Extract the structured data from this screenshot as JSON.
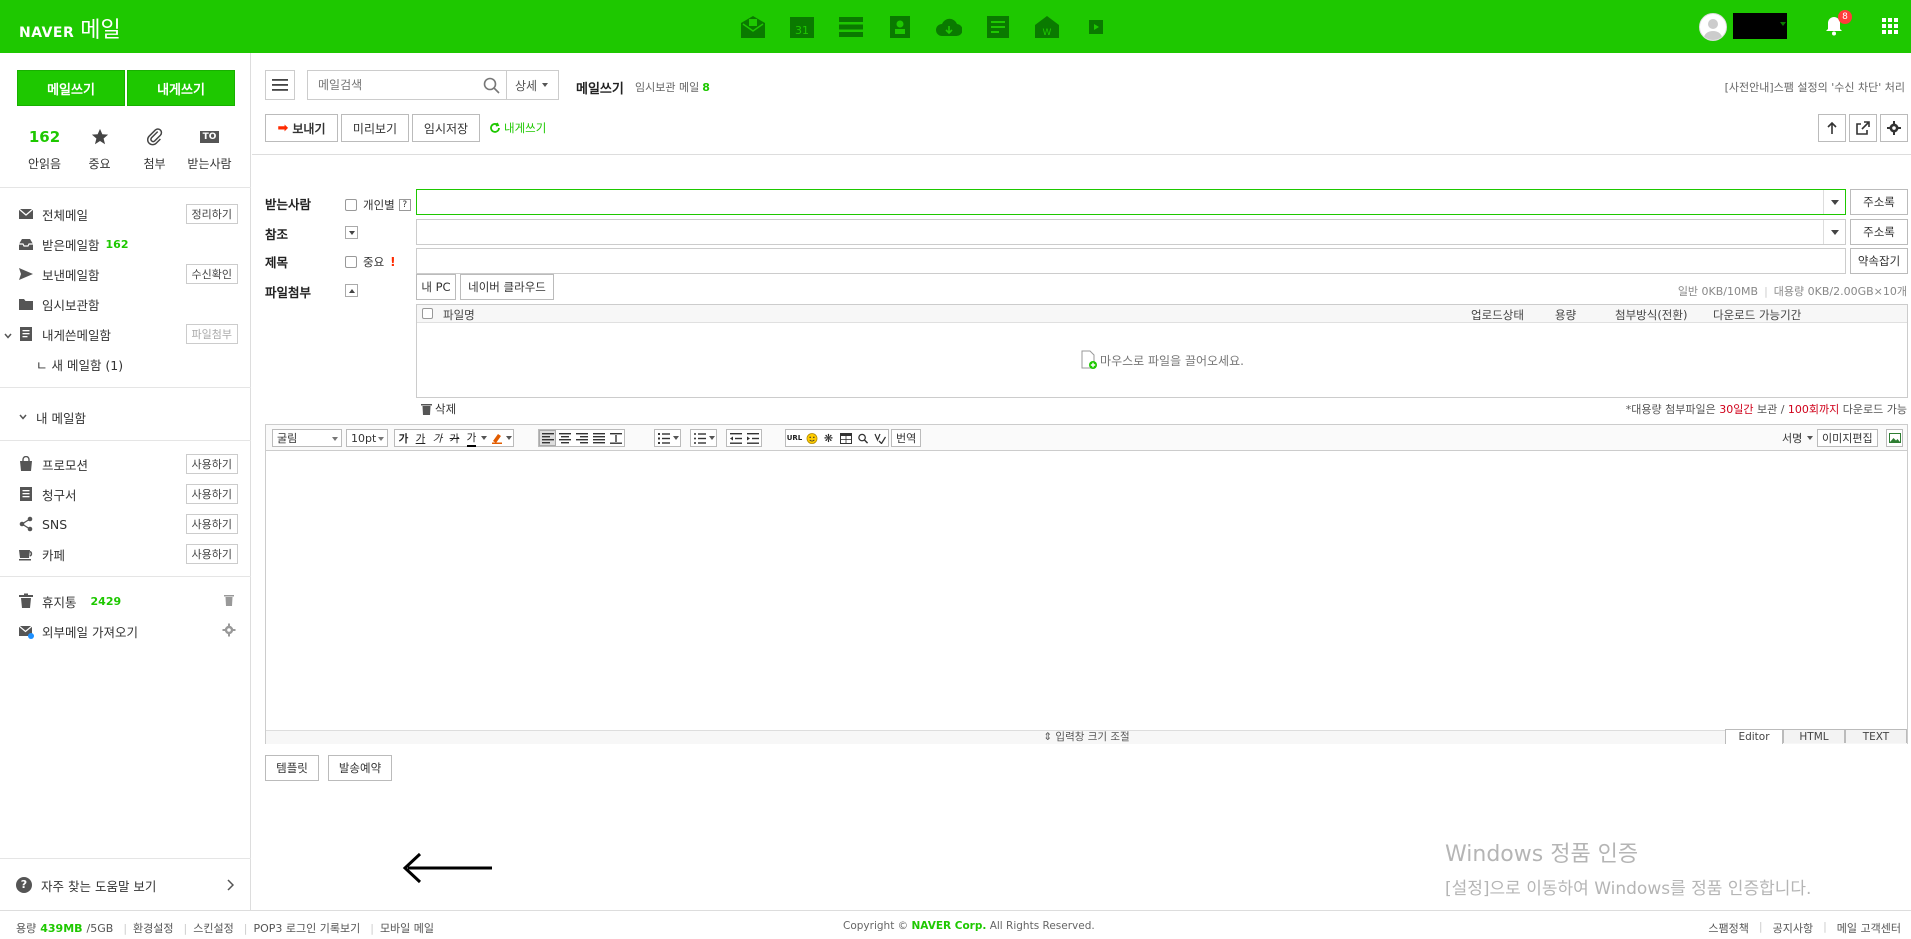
{
  "header": {
    "brand": "NAVER",
    "product": "메일",
    "notification_count": "8"
  },
  "sidebar": {
    "compose_label": "메일쓰기",
    "self_compose_label": "내게쓰기",
    "quick": [
      {
        "value": "162",
        "label": "안읽음"
      },
      {
        "label": "중요"
      },
      {
        "label": "첨부"
      },
      {
        "badge": "TO",
        "label": "받는사람"
      }
    ],
    "folders": [
      {
        "label": "전체메일",
        "button": "정리하기"
      },
      {
        "label": "받은메일함",
        "count": "162"
      },
      {
        "label": "보낸메일함",
        "button": "수신확인"
      },
      {
        "label": "임시보관함"
      },
      {
        "label": "내게쓴메일함",
        "button": "파일첨부"
      },
      {
        "label": "ㄴ 새 메일함 (1)"
      }
    ],
    "my_mailbox_label": "내 메일함",
    "apps": [
      {
        "label": "프로모션",
        "button": "사용하기"
      },
      {
        "label": "청구서",
        "button": "사용하기"
      },
      {
        "label": "SNS",
        "button": "사용하기"
      },
      {
        "label": "카페",
        "button": "사용하기"
      }
    ],
    "trash": {
      "label": "휴지통",
      "count": "2429"
    },
    "external": {
      "label": "외부메일 가져오기"
    },
    "help_label": "자주 찾는 도움말 보기"
  },
  "main": {
    "search_placeholder": "메일검색",
    "detail_label": "상세",
    "title": "메일쓰기",
    "draft_label": "임시보관 메일",
    "draft_count": "8",
    "notice": "[사전안내]스팸 설정의 '수신 차단' 처리",
    "toolbar": {
      "send": "보내기",
      "preview": "미리보기",
      "save": "임시저장",
      "self_write": "내게쓰기"
    },
    "form": {
      "to_label": "받는사람",
      "personal_label": "개인별",
      "help_mark": "?",
      "address_book": "주소록",
      "cc_label": "참조",
      "subject_label": "제목",
      "important_label": "중요",
      "important_mark": "!",
      "signature_btn": "약속잡기",
      "attach_label": "파일첨부",
      "my_pc": "내 PC",
      "cloud": "네이버 클라우드",
      "quota_normal": "일반 0KB/10MB",
      "quota_big": "대용량 0KB/2.00GB×10개"
    },
    "file_table": {
      "columns": [
        "파일명",
        "업로드상태",
        "용량",
        "첨부방식(전환)",
        "다운로드 가능기간"
      ],
      "drop_text": "마우스로 파일을 끌어오세요.",
      "delete": "삭제",
      "note_prefix": "*대용량 첨부파일은 ",
      "note_days": "30일간",
      "note_mid": " 보관 / ",
      "note_times": "100회까지",
      "note_suffix": " 다운로드 가능"
    },
    "editor": {
      "font": "굴림",
      "size": "10pt",
      "translate": "번역",
      "sign": "서명",
      "image_edit": "이미지편집",
      "resize": "입력창 크기 조절",
      "modes": [
        "Editor",
        "HTML",
        "TEXT"
      ]
    },
    "bottom": {
      "template": "템플릿",
      "schedule": "발송예약"
    }
  },
  "footer": {
    "usage_label": "용량",
    "usage_value": "439MB",
    "usage_total": "/5GB",
    "links_left": [
      "환경설정",
      "스킨설정",
      "POP3 로그인 기록보기",
      "모바일 메일"
    ],
    "copyright_prefix": "Copyright ©",
    "copyright_brand": "NAVER Corp.",
    "copyright_suffix": "All Rights Reserved.",
    "links_right": [
      "스팸정책",
      "공지사항",
      "메일 고객센터"
    ]
  },
  "watermark": {
    "line1": "Windows 정품 인증",
    "line2": "[설정]으로 이동하여 Windows를 정품 인증합니다."
  }
}
